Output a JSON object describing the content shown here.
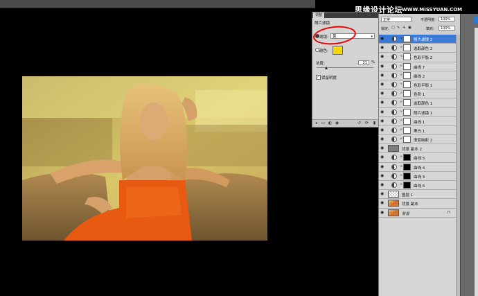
{
  "menubar": {
    "items": [
      "",
      "",
      "",
      ""
    ]
  },
  "watermark": {
    "text": "思缘设计论坛",
    "url": "WWW.MISSYUAN.COM"
  },
  "adjustments_panel": {
    "title_tab": "调整",
    "section": "照片滤镜",
    "filter_label": "滤镜:",
    "filter_value": "黄",
    "color_label": "颜色:",
    "density_label": "浓度:",
    "density_value": "21",
    "density_unit": "%",
    "density_percent": 21,
    "preserve_label": "保留明度",
    "accent_color": "#f8d600"
  },
  "layers_panel": {
    "blend_mode": "正常",
    "opacity_label": "不透明度:",
    "opacity_value": "100%",
    "lock_label": "锁定:",
    "fill_label": "填充:",
    "fill_value": "100%",
    "layers": [
      {
        "name": "照片滤镜 2",
        "kind": "adjustment",
        "mask": "white",
        "selected": true
      },
      {
        "name": "选取颜色 2",
        "kind": "adjustment",
        "mask": "white"
      },
      {
        "name": "色彩平衡 2",
        "kind": "adjustment",
        "mask": "white"
      },
      {
        "name": "曲线 7",
        "kind": "adjustment",
        "mask": "white"
      },
      {
        "name": "曲线 2",
        "kind": "adjustment",
        "mask": "white"
      },
      {
        "name": "色彩平衡 1",
        "kind": "adjustment",
        "mask": "white"
      },
      {
        "name": "色阶 1",
        "kind": "adjustment",
        "mask": "white"
      },
      {
        "name": "选取颜色 1",
        "kind": "adjustment",
        "mask": "white"
      },
      {
        "name": "照片滤镜 1",
        "kind": "adjustment",
        "mask": "white"
      },
      {
        "name": "曲线 1",
        "kind": "adjustment",
        "mask": "white"
      },
      {
        "name": "黑白 1",
        "kind": "adjustment",
        "mask": "white"
      },
      {
        "name": "渐变映射 2",
        "kind": "adjustment",
        "mask": "white"
      },
      {
        "name": "背景 副本 2",
        "kind": "pixel-gray"
      },
      {
        "name": "曲线 5",
        "kind": "adjustment",
        "mask": "black"
      },
      {
        "name": "曲线 4",
        "kind": "adjustment",
        "mask": "black"
      },
      {
        "name": "曲线 3",
        "kind": "adjustment",
        "mask": "black"
      },
      {
        "name": "曲线 6",
        "kind": "adjustment",
        "mask": "black"
      },
      {
        "name": "图层 1",
        "kind": "pixel-transparent"
      },
      {
        "name": "背景 副本",
        "kind": "pixel-photo"
      },
      {
        "name": "背景",
        "kind": "background"
      }
    ]
  }
}
